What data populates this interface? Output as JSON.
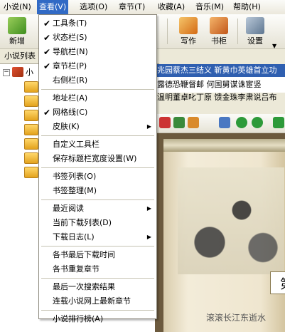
{
  "menubar": [
    "小说(N)",
    "查看(V)",
    "选项(O)",
    "章节(T)",
    "收藏(A)",
    "音乐(M)",
    "帮助(H)"
  ],
  "toolbar": {
    "new_label": "新增",
    "write_label": "写作",
    "shelf_label": "书柜",
    "settings_label": "设置"
  },
  "left_panel": {
    "title": "小说列表",
    "root_label": "小"
  },
  "tabs": {
    "line1": "兆园蔡杰三结义  靳黄巾英雄首立功",
    "line2": "露德恐鞭督邮  何国舅谋诛宦竖",
    "line3": "温明董卓叱丁原  馈金珠李肃说吕布"
  },
  "reader": {
    "chapter": "第",
    "text": "滚滚长江东逝水"
  },
  "view_menu": {
    "items": [
      {
        "label": "工具条(T)",
        "checked": true,
        "submenu": false
      },
      {
        "label": "状态栏(S)",
        "checked": true,
        "submenu": false
      },
      {
        "label": "导航栏(N)",
        "checked": true,
        "submenu": false
      },
      {
        "label": "章节栏(P)",
        "checked": true,
        "submenu": false
      },
      {
        "label": "右侧栏(R)",
        "checked": false,
        "submenu": false
      },
      {
        "label": "地址栏(A)",
        "checked": false,
        "submenu": false
      },
      {
        "label": "网格线(C)",
        "checked": true,
        "submenu": false
      },
      {
        "label": "皮肤(K)",
        "checked": false,
        "submenu": true
      },
      {
        "label": "自定义工具栏",
        "checked": false,
        "submenu": false
      },
      {
        "label": "保存标题栏宽度设置(W)",
        "checked": false,
        "submenu": false
      },
      {
        "label": "书签列表(O)",
        "checked": false,
        "submenu": false
      },
      {
        "label": "书签整理(M)",
        "checked": false,
        "submenu": false
      },
      {
        "label": "最近阅读",
        "checked": false,
        "submenu": true
      },
      {
        "label": "当前下载列表(D)",
        "checked": false,
        "submenu": false
      },
      {
        "label": "下载日志(L)",
        "checked": false,
        "submenu": true
      },
      {
        "label": "各书最后下载时间",
        "checked": false,
        "submenu": false
      },
      {
        "label": "各书重复章节",
        "checked": false,
        "submenu": false
      },
      {
        "label": "最后一次搜索结果",
        "checked": false,
        "submenu": false
      },
      {
        "label": "连载小说网上最新章节",
        "checked": false,
        "submenu": false
      },
      {
        "label": "小说排行榜(A)",
        "checked": false,
        "submenu": false
      }
    ],
    "check_glyph": "✔",
    "arrow_glyph": "▶"
  },
  "colors": {
    "highlight": "#316ac5",
    "tab_blue": "#2f5fb0"
  }
}
